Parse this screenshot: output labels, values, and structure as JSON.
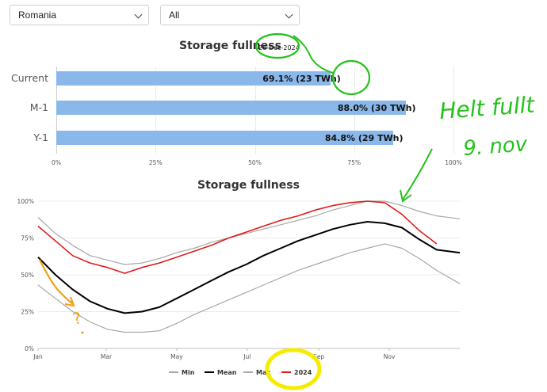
{
  "filters": {
    "country": "Romania",
    "period": "All"
  },
  "bar_chart": {
    "title": "Storage fullness",
    "date": "26-Dec-2024"
  },
  "line_chart": {
    "title": "Storage fullness"
  },
  "colors": {
    "bar": "#8ab8ea",
    "min": "#a8a8a8",
    "mean": "#000000",
    "max": "#a8a8a8",
    "y2024": "#e01b1b",
    "annotation_green": "#25c21b",
    "annotation_orange": "#f0a21a",
    "annotation_yellow": "#f5ec00"
  },
  "annotations": {
    "green_text_line1": "Helt fullt",
    "green_text_line2": "9. nov",
    "orange_mark": "?"
  },
  "chart_data": [
    {
      "type": "bar",
      "orientation": "horizontal",
      "title": "Storage fullness",
      "subtitle": "26-Dec-2024",
      "categories": [
        "Current",
        "M-1",
        "Y-1"
      ],
      "values": [
        69.1,
        88.0,
        84.8
      ],
      "value_labels": [
        "69.1% (23 TWh)",
        "88.0% (30 TWh)",
        "84.8% (29 TWh)"
      ],
      "x_ticks": [
        "0%",
        "25%",
        "50%",
        "75%",
        "100%"
      ],
      "xlim": [
        0,
        100
      ]
    },
    {
      "type": "line",
      "title": "Storage fullness",
      "x_ticks": [
        "Jan",
        "Mar",
        "May",
        "Jul",
        "Sep",
        "Nov"
      ],
      "y_ticks": [
        "0%",
        "25%",
        "50%",
        "75%",
        "100%"
      ],
      "ylim": [
        0,
        100
      ],
      "legend_position": "bottom",
      "x_day_of_year": [
        0,
        15,
        30,
        45,
        60,
        75,
        90,
        105,
        120,
        135,
        150,
        165,
        180,
        195,
        210,
        225,
        240,
        255,
        270,
        285,
        300,
        315,
        330,
        345,
        365
      ],
      "series": [
        {
          "name": "Min",
          "values": [
            43,
            34,
            25,
            18,
            13,
            11,
            11,
            12,
            17,
            23,
            28,
            33,
            38,
            43,
            48,
            53,
            57,
            61,
            65,
            68,
            71,
            68,
            61,
            53,
            44
          ]
        },
        {
          "name": "Mean",
          "values": [
            62,
            50,
            40,
            32,
            27,
            24,
            25,
            28,
            34,
            40,
            46,
            52,
            57,
            63,
            68,
            73,
            77,
            81,
            84,
            86,
            85,
            82,
            74,
            67,
            65
          ]
        },
        {
          "name": "Max",
          "values": [
            89,
            78,
            70,
            63,
            60,
            57,
            58,
            61,
            65,
            68,
            72,
            75,
            78,
            81,
            84,
            87,
            90,
            94,
            97,
            100,
            100,
            97,
            93,
            90,
            88
          ]
        },
        {
          "name": "2024",
          "values": [
            83,
            73,
            63,
            58,
            55,
            51,
            55,
            58,
            62,
            66,
            70,
            75,
            79,
            83,
            87,
            90,
            94,
            97,
            99,
            100,
            99,
            91,
            80,
            71,
            null
          ]
        }
      ]
    }
  ]
}
